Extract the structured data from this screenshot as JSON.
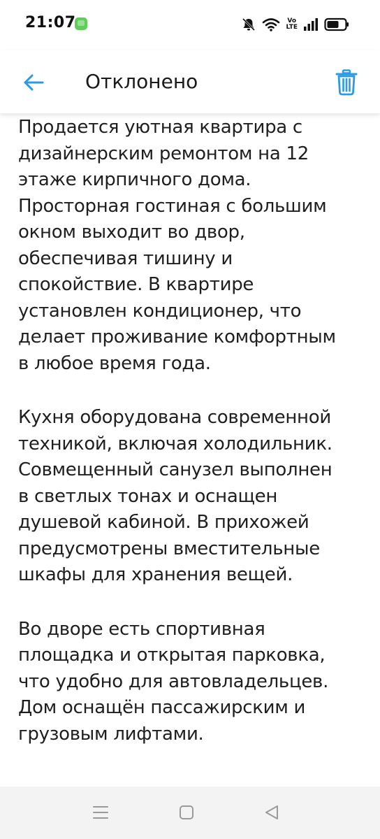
{
  "status_bar": {
    "time": "21:07",
    "network_label_top": "Vo",
    "network_label_bottom": "LTE"
  },
  "header": {
    "title": "Отклонено"
  },
  "content": {
    "paragraphs": [
      "Продается уютная квартира с\nдизайнерским ремонтом на 12\nэтаже кирпичного дома.\nПросторная гостиная с большим\nокном выходит во двор,\nобеспечивая тишину и\nспокойствие. В квартире\nустановлен кондиционер, что\nделает проживание комфортным\nв любое время года.",
      "Кухня оборудована современной\nтехникой, включая холодильник.\nСовмещенный санузел выполнен\nв светлых тонах и оснащен\nдушевой кабиной. В прихожей\nпредусмотрены вместительные\nшкафы для хранения вещей.",
      "Во дворе есть спортивная\nплощадка и открытая парковка,\nчто удобно для автовладельцев.\nДом оснащён пассажирским и\nгрузовым лифтами."
    ]
  },
  "icons": {
    "back": "arrow-left-icon",
    "delete": "trash-icon",
    "menu": "menu-icon",
    "home": "home-icon",
    "nav_back": "triangle-back-icon"
  },
  "colors": {
    "accent": "#2b9be6",
    "text": "#1f1f1f",
    "nav_bar": "#f3f3f3",
    "app_icon": "#5fce59"
  }
}
